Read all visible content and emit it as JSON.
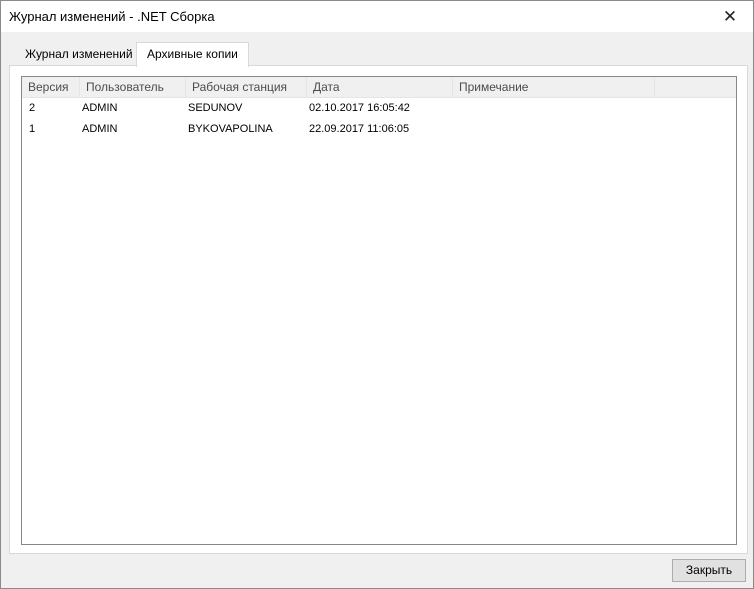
{
  "window": {
    "title": "Журнал изменений - .NET Сборка",
    "close_symbol": "✕"
  },
  "tabs": [
    {
      "label": "Журнал изменений",
      "active": false
    },
    {
      "label": "Архивные копии",
      "active": true
    }
  ],
  "table": {
    "columns": [
      "Версия",
      "Пользователь",
      "Рабочая станция",
      "Дата",
      "Примечание"
    ],
    "rows": [
      [
        "2",
        "ADMIN",
        "SEDUNOV",
        "02.10.2017 16:05:42",
        ""
      ],
      [
        "1",
        "ADMIN",
        "BYKOVAPOLINA",
        "22.09.2017 11:06:05",
        ""
      ]
    ]
  },
  "footer": {
    "close_label": "Закрыть"
  }
}
